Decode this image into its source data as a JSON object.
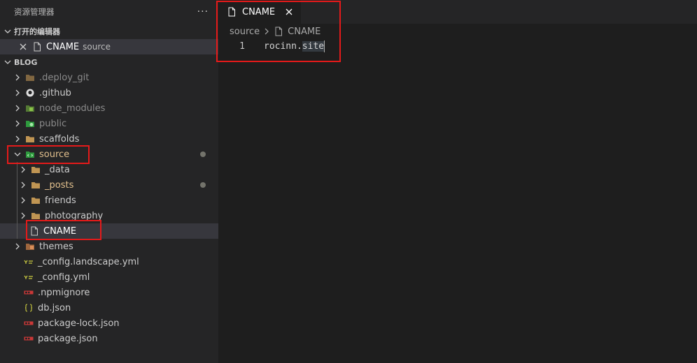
{
  "sidebar": {
    "title": "资源管理器",
    "more": "···",
    "open_editors": {
      "header": "打开的编辑器",
      "items": [
        {
          "name": "CNAME",
          "folder": "source"
        }
      ]
    },
    "project": {
      "header": "BLOG",
      "items": [
        {
          "label": ".deploy_git",
          "type": "folder",
          "icon": "folder-icon"
        },
        {
          "label": ".github",
          "type": "folder",
          "icon": "github-folder-icon"
        },
        {
          "label": "node_modules",
          "type": "folder",
          "icon": "node-modules-folder-icon"
        },
        {
          "label": "public",
          "type": "folder",
          "icon": "public-folder-icon"
        },
        {
          "label": "scaffolds",
          "type": "folder",
          "icon": "folder-icon"
        },
        {
          "label": "source",
          "type": "folder",
          "icon": "source-folder-icon",
          "expanded": true,
          "modified": true
        },
        {
          "label": "_data",
          "type": "folder",
          "icon": "folder-icon"
        },
        {
          "label": "_posts",
          "type": "folder",
          "icon": "folder-icon",
          "modified": true
        },
        {
          "label": "friends",
          "type": "folder",
          "icon": "folder-icon"
        },
        {
          "label": "photography",
          "type": "folder",
          "icon": "folder-icon"
        },
        {
          "label": "CNAME",
          "type": "file",
          "icon": "file-icon",
          "selected": true
        },
        {
          "label": "themes",
          "type": "folder",
          "icon": "themes-folder-icon"
        },
        {
          "label": "_config.landscape.yml",
          "type": "file",
          "icon": "yaml-icon"
        },
        {
          "label": "_config.yml",
          "type": "file",
          "icon": "yaml-icon"
        },
        {
          "label": ".npmignore",
          "type": "file",
          "icon": "npm-icon"
        },
        {
          "label": "db.json",
          "type": "file",
          "icon": "json-icon"
        },
        {
          "label": "package-lock.json",
          "type": "file",
          "icon": "npm-icon"
        },
        {
          "label": "package.json",
          "type": "file",
          "icon": "npm-icon"
        }
      ]
    }
  },
  "editor": {
    "tab": {
      "label": "CNAME"
    },
    "breadcrumb": {
      "folder": "source",
      "file": "CNAME"
    },
    "lines": [
      {
        "number": "1",
        "text_a": "rocinn.",
        "text_b": "site"
      }
    ]
  },
  "colors": {
    "annotation": "#e51a1a",
    "folder": "#c09553",
    "modified_dot": "#73736b"
  }
}
